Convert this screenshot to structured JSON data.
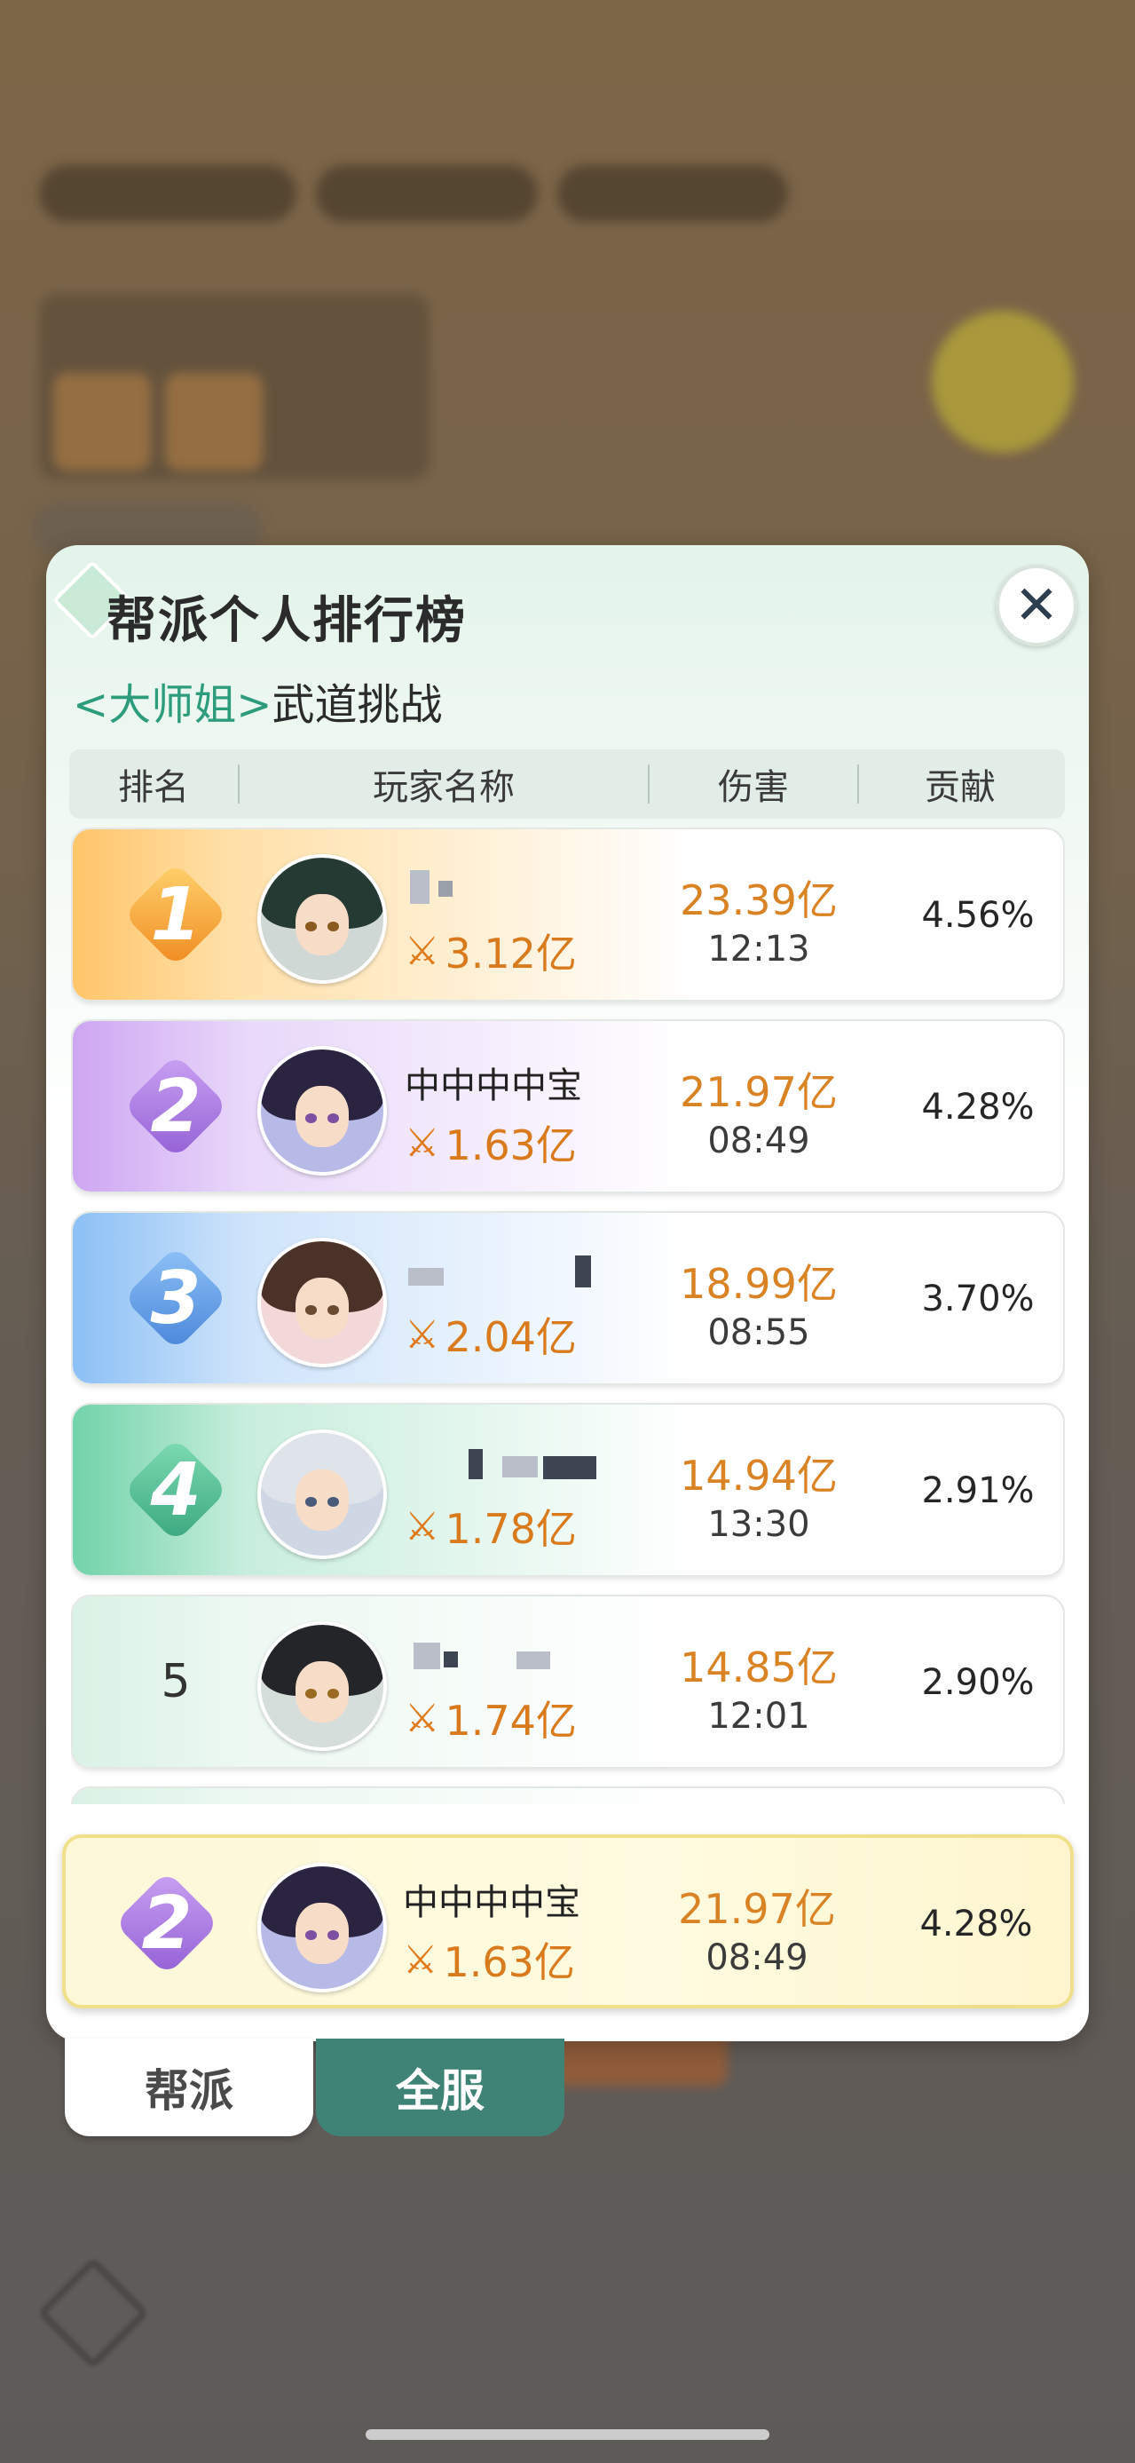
{
  "modal": {
    "title": "帮派个人排行榜",
    "subtitle_accent": "<大师姐>",
    "subtitle_rest": "武道挑战",
    "close_label": "✕"
  },
  "table": {
    "headers": [
      "排名",
      "玩家名称",
      "伤害",
      "贡献"
    ],
    "rows": [
      {
        "rank": "1",
        "name": "",
        "power": "3.12亿",
        "damage": "23.39亿",
        "time": "12:13",
        "contribution": "4.56%"
      },
      {
        "rank": "2",
        "name": "中中中中宝",
        "power": "1.63亿",
        "damage": "21.97亿",
        "time": "08:49",
        "contribution": "4.28%"
      },
      {
        "rank": "3",
        "name": "",
        "power": "2.04亿",
        "damage": "18.99亿",
        "time": "08:55",
        "contribution": "3.70%"
      },
      {
        "rank": "4",
        "name": "",
        "power": "1.78亿",
        "damage": "14.94亿",
        "time": "13:30",
        "contribution": "2.91%"
      },
      {
        "rank": "5",
        "name": "",
        "power": "1.74亿",
        "damage": "14.85亿",
        "time": "12:01",
        "contribution": "2.90%"
      }
    ]
  },
  "my_entry": {
    "rank": "2",
    "name": "中中中中宝",
    "power": "1.63亿",
    "damage": "21.97亿",
    "time": "08:49",
    "contribution": "4.28%"
  },
  "tabs": {
    "guild": "帮派",
    "server": "全服"
  },
  "colors": {
    "accent": "#2d9c7c",
    "damage": "#d98324",
    "power": "#d97a1c",
    "rank1": "#f7a540",
    "rank2": "#a87ae0",
    "rank3": "#5b9ee8",
    "rank4": "#4cbf94",
    "tab_active": "#3f8276"
  },
  "icons": {
    "power": "crossed-swords-icon",
    "close": "close-icon"
  }
}
